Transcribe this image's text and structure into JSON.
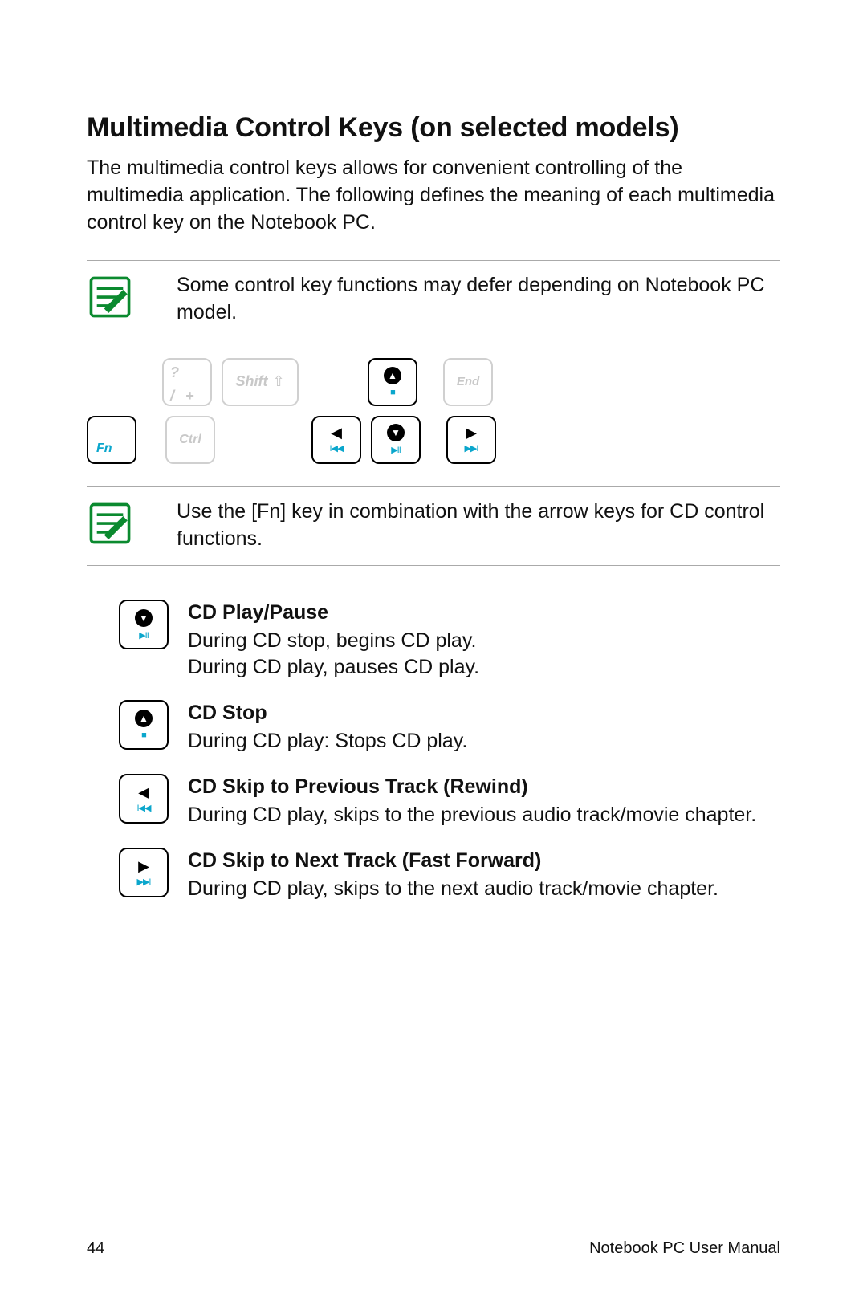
{
  "heading": "Multimedia Control Keys (on selected models)",
  "intro": "The multimedia control keys allows for convenient controlling of the multimedia application. The following defines the meaning of each multimedia control key on the Notebook PC.",
  "note1": "Some control key functions may defer depending on Notebook PC model.",
  "note2": "Use the [Fn] key in combination with the arrow keys for CD control functions.",
  "keys": {
    "slash_top": "?",
    "slash_bot_left": "/",
    "slash_bot_right": "+",
    "shift": "Shift",
    "shift_arrow": "⇧",
    "end": "End",
    "fn": "Fn",
    "ctrl": "Ctrl",
    "up_sub": "■",
    "down_sub": "▶II",
    "left_sub": "I◀◀",
    "right_sub": "▶▶I"
  },
  "desc": [
    {
      "title": "CD Play/Pause",
      "body": "During CD stop, begins CD play.\nDuring CD play, pauses CD play.",
      "icon": "down"
    },
    {
      "title": "CD Stop",
      "body": "During CD play: Stops CD play.",
      "icon": "up"
    },
    {
      "title": "CD Skip to Previous Track (Rewind)",
      "body": "During CD play, skips to the previous audio track/movie chapter.",
      "icon": "left"
    },
    {
      "title": "CD Skip to Next Track (Fast Forward)",
      "body": "During CD play, skips to the next audio track/movie chapter.",
      "icon": "right"
    }
  ],
  "footer": {
    "page": "44",
    "title": "Notebook PC User Manual"
  }
}
